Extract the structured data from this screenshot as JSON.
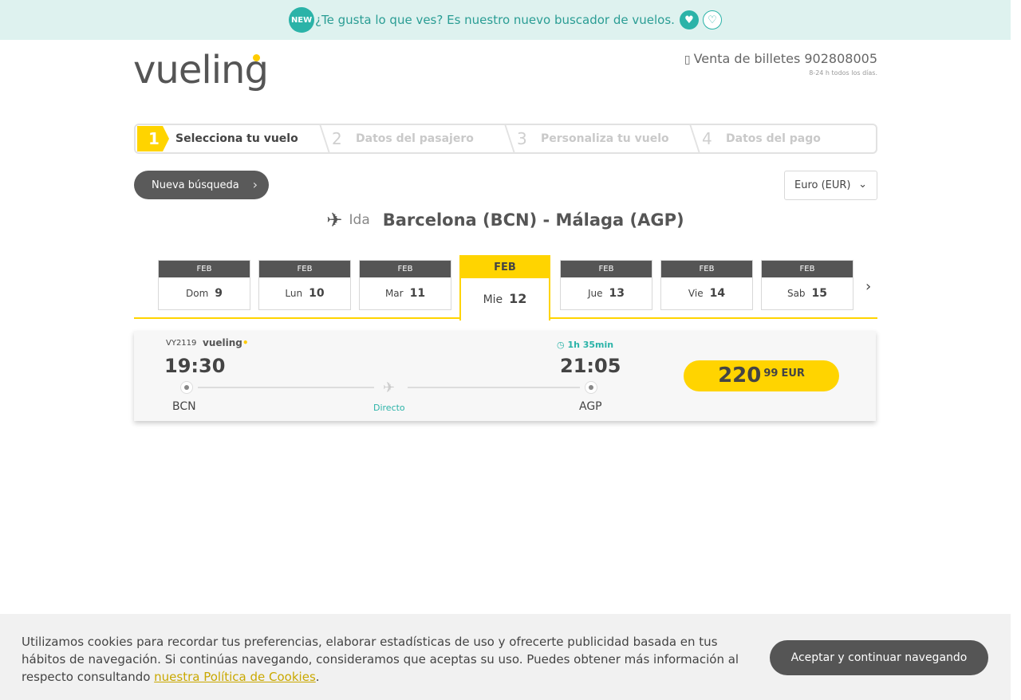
{
  "banner": {
    "new_badge": "NEW",
    "text": "¿Te gusta lo que ves? Es nuestro nuevo buscador de vuelos.",
    "heart_solid": "heart-icon",
    "heart_outline": "heart-outline-icon"
  },
  "header": {
    "logo_text": "vueling",
    "phone_label": "Venta de billetes 902808005",
    "phone_hours": "8-24 h todos los días."
  },
  "steps": [
    {
      "num": "1",
      "label": "Selecciona tu vuelo",
      "active": true
    },
    {
      "num": "2",
      "label": "Datos del pasajero",
      "active": false
    },
    {
      "num": "3",
      "label": "Personaliza tu vuelo",
      "active": false
    },
    {
      "num": "4",
      "label": "Datos del pago",
      "active": false
    }
  ],
  "controls": {
    "new_search": "Nueva búsqueda",
    "currency": "Euro (EUR)"
  },
  "route": {
    "direction": "Ida",
    "title": "Barcelona (BCN) - Málaga (AGP)"
  },
  "dates": [
    {
      "month": "FEB",
      "weekday": "Dom",
      "day": "9",
      "active": false
    },
    {
      "month": "FEB",
      "weekday": "Lun",
      "day": "10",
      "active": false
    },
    {
      "month": "FEB",
      "weekday": "Mar",
      "day": "11",
      "active": false
    },
    {
      "month": "FEB",
      "weekday": "Mie",
      "day": "12",
      "active": true
    },
    {
      "month": "FEB",
      "weekday": "Jue",
      "day": "13",
      "active": false
    },
    {
      "month": "FEB",
      "weekday": "Vie",
      "day": "14",
      "active": false
    },
    {
      "month": "FEB",
      "weekday": "Sab",
      "day": "15",
      "active": false
    }
  ],
  "flight": {
    "code": "VY2119",
    "carrier": "vueling",
    "departure_time": "19:30",
    "arrival_time": "21:05",
    "duration": "1h 35min",
    "departure_code": "BCN",
    "arrival_code": "AGP",
    "stops": "Directo",
    "price_int": "220",
    "price_dec": "99",
    "price_currency": "EUR"
  },
  "cookies": {
    "text": "Utilizamos cookies para recordar tus preferencias, elaborar estadísticas de uso y ofrecerte publicidad basada en tus hábitos de navegación. Si continúas navegando, consideramos que aceptas su uso. Puedes obtener más información al respecto consultando ",
    "link": "nuestra Política de Cookies",
    "end": ".",
    "accept": "Aceptar y continuar navegando"
  }
}
